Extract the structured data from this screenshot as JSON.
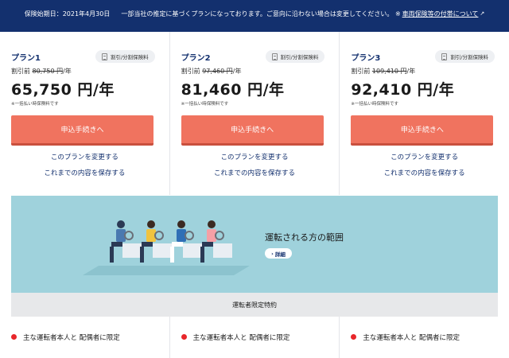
{
  "topbar": {
    "start_label": "保険始期日：",
    "start_date": "2021年4月30日",
    "notice": "一部当社の推定に基づくプランになっております。ご意向に沿わない場合は変更してください。",
    "link_prefix": "※",
    "link_text": "車両保険等の付帯について",
    "link_icon": "external-link-icon"
  },
  "plans": [
    {
      "name": "プラン1",
      "badge": "割引/分割保険料",
      "before_prefix": "割引前",
      "before_price": "80,750 円",
      "before_suffix": "/年",
      "price": "65,750 円/年",
      "note": "※一括払い時保険料です",
      "apply": "申込手続きへ",
      "change": "このプランを変更する",
      "save": "これまでの内容を保存する"
    },
    {
      "name": "プラン2",
      "badge": "割引/分割保険料",
      "before_prefix": "割引前",
      "before_price": "97,460 円",
      "before_suffix": "/年",
      "price": "81,460 円/年",
      "note": "※一括払い時保険料です",
      "apply": "申込手続きへ",
      "change": "このプランを変更する",
      "save": "これまでの内容を保存する"
    },
    {
      "name": "プラン3",
      "badge": "割引/分割保険料",
      "before_prefix": "割引前",
      "before_price": "109,410 円",
      "before_suffix": "/年",
      "price": "92,410 円/年",
      "note": "※一括払い時保険料です",
      "apply": "申込手続きへ",
      "change": "このプランを変更する",
      "save": "これまでの内容を保存する"
    }
  ],
  "banner": {
    "title": "運転される方の範囲",
    "detail": "詳細",
    "illustration": "drivers-illustration"
  },
  "section": {
    "title": "運転者限定特約"
  },
  "conditions": [
    "主な運転者本人と 配偶者に限定",
    "主な運転者本人と 配偶者に限定",
    "主な運転者本人と 配偶者に限定"
  ],
  "colors": {
    "navy": "#13306e",
    "apply": "#f0735f",
    "banner": "#9fd2dc",
    "dot": "#e8262a"
  }
}
